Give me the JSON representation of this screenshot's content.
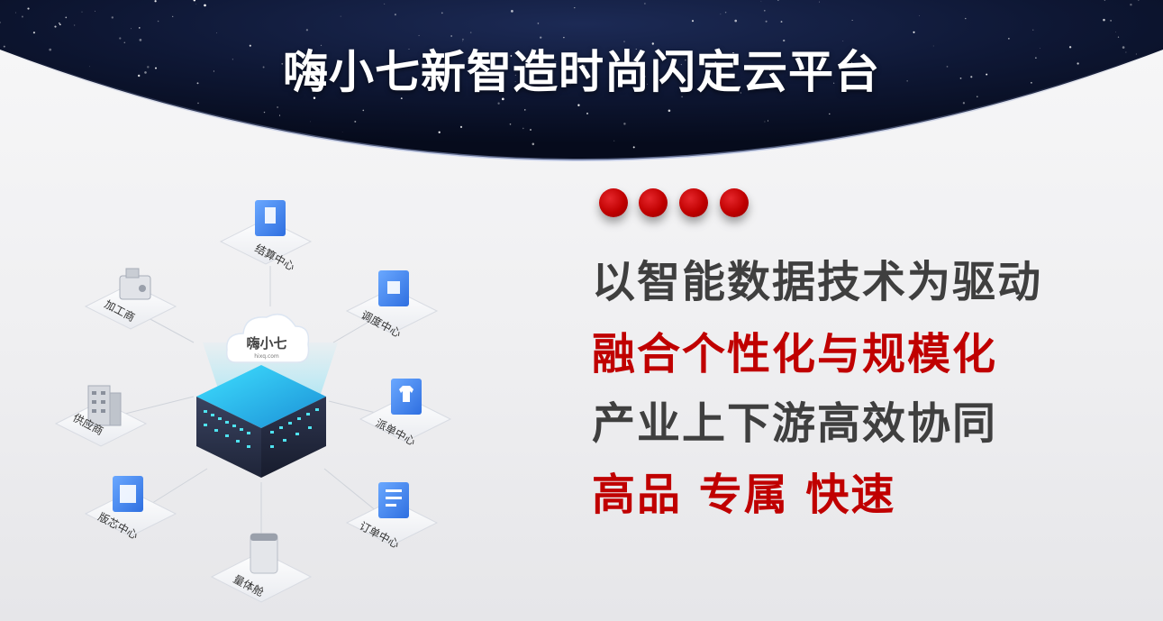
{
  "header": {
    "title": "嗨小七新智造时尚闪定云平台"
  },
  "slogans": [
    {
      "text": "以智能数据技术为驱动",
      "tone": "dark"
    },
    {
      "text": "融合个性化与规模化",
      "tone": "red"
    },
    {
      "text": "产业上下游高效协同",
      "tone": "dark"
    },
    {
      "text": "高品 专属 快速",
      "tone": "red"
    }
  ],
  "diagram": {
    "center_logo": "嗨小七",
    "center_logo_sub": "hixq.com",
    "nodes": {
      "settlement": "结算中心",
      "dispatch": "调度中心",
      "order_assign": "派单中心",
      "order": "订单中心",
      "measure_cabin": "量体舱",
      "pattern": "版芯中心",
      "supplier": "供应商",
      "processor": "加工商"
    }
  },
  "colors": {
    "accent_red": "#c00000",
    "text_dark": "#3f3f3f",
    "sky_dark": "#0c1530",
    "tile_blue": "#3d86f0",
    "server_dark": "#2a3148",
    "led_cyan": "#4fe3f0"
  }
}
